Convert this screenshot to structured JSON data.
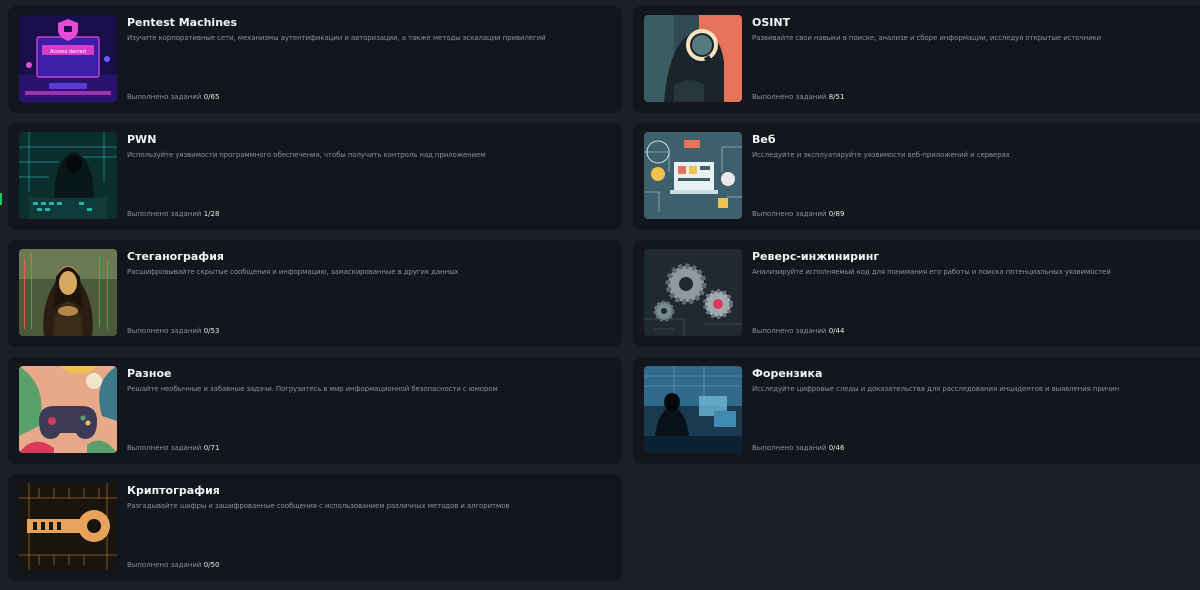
{
  "progress_label": "Выполнено заданий",
  "cards": [
    {
      "id": "pentest",
      "title": "Pentest Machines",
      "description": "Изучите корпоративные сети, механизмы аутентификации и авторизации, а также методы эскалации привилегий",
      "count": "0/65",
      "image_text": "Access denied"
    },
    {
      "id": "osint",
      "title": "OSINT",
      "description": "Развивайте свои навыки в поиске, анализе и сборе информации, исследуя открытые источники",
      "count": "8/51"
    },
    {
      "id": "pwn",
      "title": "PWN",
      "description": "Используйте уязвимости программного обеспечения, чтобы получить контроль над приложением",
      "count": "1/28"
    },
    {
      "id": "web",
      "title": "Веб",
      "description": "Исследуйте и эксплуатируйте уязвимости веб-приложений и серверах",
      "count": "0/89"
    },
    {
      "id": "stego",
      "title": "Стеганография",
      "description": "Расшифровывайте скрытые сообщения и информацию, замаскированные в других данных",
      "count": "0/53"
    },
    {
      "id": "reverse",
      "title": "Реверс-инжиниринг",
      "description": "Анализируйте исполняемый код для понимания его работы и поиска потенциальных уязвимостей",
      "count": "0/44"
    },
    {
      "id": "misc",
      "title": "Разное",
      "description": "Решайте необычные и забавные задачи. Погрузитесь в мир информационной безопасности с юмором",
      "count": "0/71"
    },
    {
      "id": "forensics",
      "title": "Форензика",
      "description": "Исследуйте цифровые следы и доказательства для расследования инцидентов и выявления причин",
      "count": "0/46"
    },
    {
      "id": "crypto",
      "title": "Криптография",
      "description": "Разгадывайте шифры и зашифрованные сообщения с использованием различных методов и алгоритмов",
      "count": "0/50"
    }
  ],
  "colors": {
    "background": "#1c1f26",
    "card": "#13161c",
    "title": "#f3f4f6",
    "muted": "#8a909b"
  }
}
